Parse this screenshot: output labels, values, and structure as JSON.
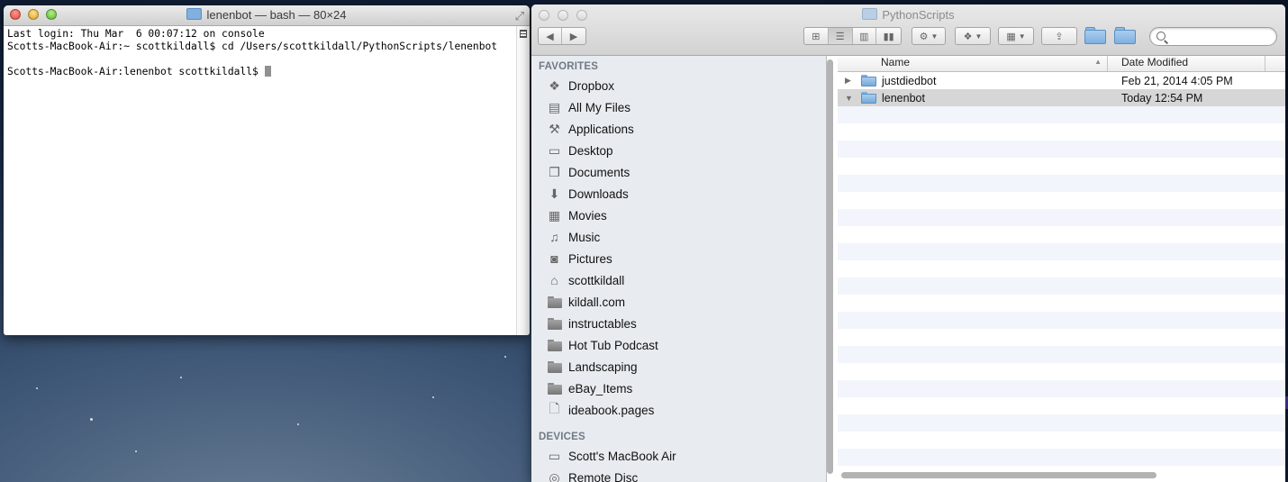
{
  "terminal": {
    "title": "lenenbot — bash — 80×24",
    "lines": [
      "Last login: Thu Mar  6 00:07:12 on console",
      "Scotts-MacBook-Air:~ scottkildall$ cd /Users/scottkildall/PythonScripts/lenenbot",
      "",
      "Scotts-MacBook-Air:lenenbot scottkildall$ "
    ]
  },
  "finder": {
    "title": "PythonScripts",
    "toolbar": {
      "back_icon": "back-arrow-icon",
      "forward_icon": "forward-arrow-icon",
      "views": [
        "icon-view",
        "list-view",
        "column-view",
        "coverflow-view"
      ],
      "search_placeholder": ""
    },
    "sidebar": {
      "favorites_label": "FAVORITES",
      "favorites": [
        {
          "label": "Dropbox",
          "icon": "dropbox-icon"
        },
        {
          "label": "All My Files",
          "icon": "all-files-icon"
        },
        {
          "label": "Applications",
          "icon": "applications-icon"
        },
        {
          "label": "Desktop",
          "icon": "desktop-icon"
        },
        {
          "label": "Documents",
          "icon": "documents-icon"
        },
        {
          "label": "Downloads",
          "icon": "downloads-icon"
        },
        {
          "label": "Movies",
          "icon": "movies-icon"
        },
        {
          "label": "Music",
          "icon": "music-icon"
        },
        {
          "label": "Pictures",
          "icon": "pictures-icon"
        },
        {
          "label": "scottkildall",
          "icon": "home-icon"
        },
        {
          "label": "kildall.com",
          "icon": "folder-icon"
        },
        {
          "label": "instructables",
          "icon": "folder-icon"
        },
        {
          "label": "Hot Tub Podcast",
          "icon": "folder-icon"
        },
        {
          "label": "Landscaping",
          "icon": "folder-icon"
        },
        {
          "label": "eBay_Items",
          "icon": "folder-icon"
        },
        {
          "label": "ideabook.pages",
          "icon": "document-icon"
        }
      ],
      "devices_label": "DEVICES",
      "devices": [
        {
          "label": "Scott's MacBook Air",
          "icon": "laptop-icon"
        },
        {
          "label": "Remote Disc",
          "icon": "disc-icon"
        }
      ]
    },
    "list": {
      "col_name": "Name",
      "col_date": "Date Modified",
      "rows": [
        {
          "name": "justdiedbot",
          "date": "Feb 21, 2014 4:05 PM",
          "expanded": false
        },
        {
          "name": "lenenbot",
          "date": "Today 12:54 PM",
          "expanded": true
        }
      ]
    }
  }
}
